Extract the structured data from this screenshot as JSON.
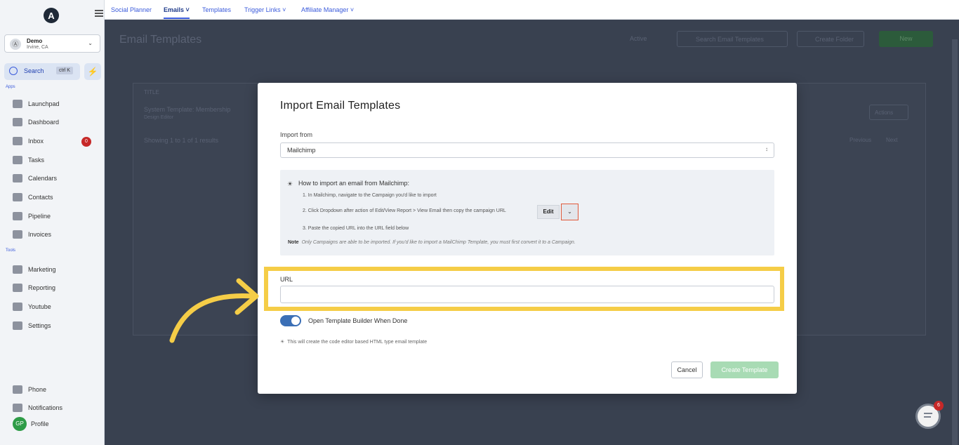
{
  "sidebar": {
    "logo": "A",
    "location": {
      "initial": "Ⓐ",
      "name": "Demo",
      "sub": "Irvine, CA"
    },
    "search": {
      "label": "Search",
      "shortcut": "ctrl K"
    },
    "section_apps": "Apps",
    "section_tools": "Tools",
    "items": [
      {
        "label": "Launchpad",
        "icon": "rocket-icon"
      },
      {
        "label": "Dashboard",
        "icon": "dashboard-icon"
      },
      {
        "label": "Inbox",
        "icon": "inbox-icon",
        "badge": "0"
      },
      {
        "label": "Tasks",
        "icon": "tasks-icon"
      },
      {
        "label": "Calendars",
        "icon": "calendar-icon"
      },
      {
        "label": "Contacts",
        "icon": "contacts-icon"
      },
      {
        "label": "Pipeline",
        "icon": "pipeline-icon"
      },
      {
        "label": "Invoices",
        "icon": "invoice-icon"
      }
    ],
    "tools": [
      {
        "label": "Marketing",
        "icon": "megaphone-icon"
      },
      {
        "label": "Reporting",
        "icon": "chart-icon"
      },
      {
        "label": "Youtube",
        "icon": "youtube-icon"
      },
      {
        "label": "Settings",
        "icon": "gear-icon"
      }
    ],
    "bottom": [
      {
        "label": "Phone",
        "icon": "phone-icon"
      },
      {
        "label": "Notifications",
        "icon": "bell-icon"
      },
      {
        "label": "Profile",
        "initials": "GP"
      }
    ]
  },
  "topbar": {
    "tabs": [
      "Social Planner",
      "Emails ˅",
      "Templates",
      "Trigger Links ˅",
      "Affiliate Manager ˅"
    ]
  },
  "background": {
    "page_title": "Email Templates",
    "filter": "Active",
    "search_placeholder": "Search Email Templates",
    "create_folder": "Create Folder",
    "new": "New",
    "col_title": "TITLE",
    "row_title": "System Template: Membership",
    "row_sub": "Design Editor",
    "showing": "Showing 1 to 1 of 1 results",
    "actions": "Actions",
    "previous": "Previous",
    "next": "Next"
  },
  "modal": {
    "title": "Import Email Templates",
    "import_from_label": "Import from",
    "import_from_value": "Mailchimp",
    "how_to": "How to import an email from Mailchimp:",
    "steps": [
      "1. In Mailchimp, navigate to the Campaign you'd like to import",
      "2. Click Dropdown after action of Edit/View Report > View Email then copy the campaign URL",
      "3. Paste the copied URL into the URL field below"
    ],
    "edit_label": "Edit",
    "note_label": "Note",
    "note_text": "Only Campaigns are able to be imported. If you'd like to import a MailChimp Template, you must first convert it to a Campaign.",
    "url_label": "URL",
    "url_value": "",
    "toggle_label": "Open Template Builder When Done",
    "toggle_on": true,
    "hint": "This will create the code editor based HTML type email template",
    "cancel": "Cancel",
    "create": "Create Template"
  },
  "chat_badge": "6",
  "colors": {
    "highlight": "#f5cd47",
    "accent": "#3b5bdb",
    "create_disabled": "#a8dbb4"
  }
}
